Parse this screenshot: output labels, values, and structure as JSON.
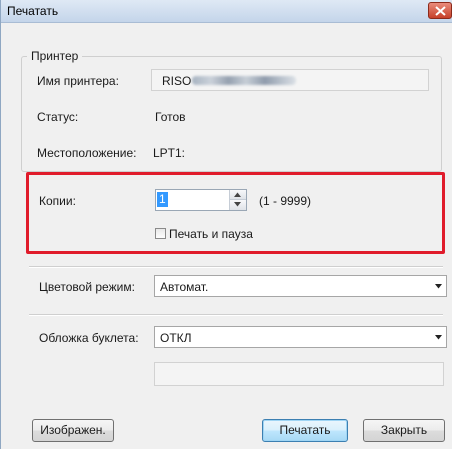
{
  "window": {
    "title": "Печатать"
  },
  "printer_group": {
    "legend": "Принтер",
    "name_label": "Имя принтера:",
    "name_value": "RISO",
    "status_label": "Статус:",
    "status_value": "Готов",
    "location_label": "Местоположение:",
    "location_value": "LPT1:"
  },
  "copies": {
    "label": "Копии:",
    "value": "1",
    "range": "(1 - 9999)",
    "pause_checkbox_label": "Печать и пауза",
    "pause_checked": false
  },
  "color_mode": {
    "label": "Цветовой режим:",
    "selected": "Автомат."
  },
  "booklet_cover": {
    "label": "Обложка буклета:",
    "selected": "ОТКЛ"
  },
  "buttons": {
    "image": "Изображен.",
    "print": "Печатать",
    "close": "Закрыть"
  },
  "colors": {
    "highlight": "#e01b2b",
    "selection": "#3399ff"
  }
}
